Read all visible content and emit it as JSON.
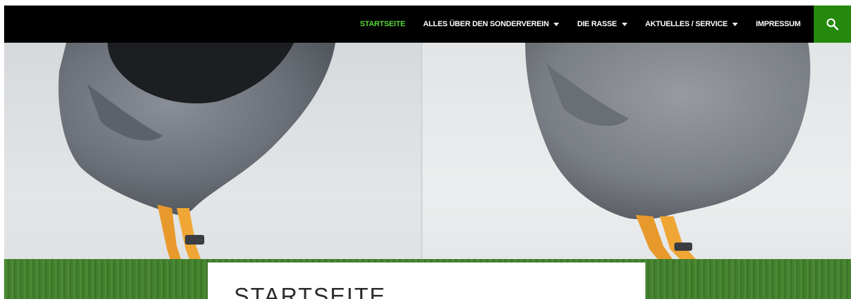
{
  "nav": {
    "items": [
      {
        "label": "STARTSEITE",
        "active": true,
        "dropdown": false
      },
      {
        "label": "ALLES ÜBER DEN SONDERVEREIN",
        "active": false,
        "dropdown": true
      },
      {
        "label": "DIE RASSE",
        "active": false,
        "dropdown": true
      },
      {
        "label": "AKTUELLES / SERVICE",
        "active": false,
        "dropdown": true
      },
      {
        "label": "IMPRESSUM",
        "active": false,
        "dropdown": false
      }
    ],
    "search_icon": "search-icon"
  },
  "hero": {
    "image": "two-grey-chickens-legs-with-orange-feet-and-leg-rings-on-green-turf"
  },
  "content": {
    "title": "STARTSEITE"
  },
  "colors": {
    "navbar_bg": "#000000",
    "active_link": "#55d737",
    "search_bg": "#24890d"
  }
}
